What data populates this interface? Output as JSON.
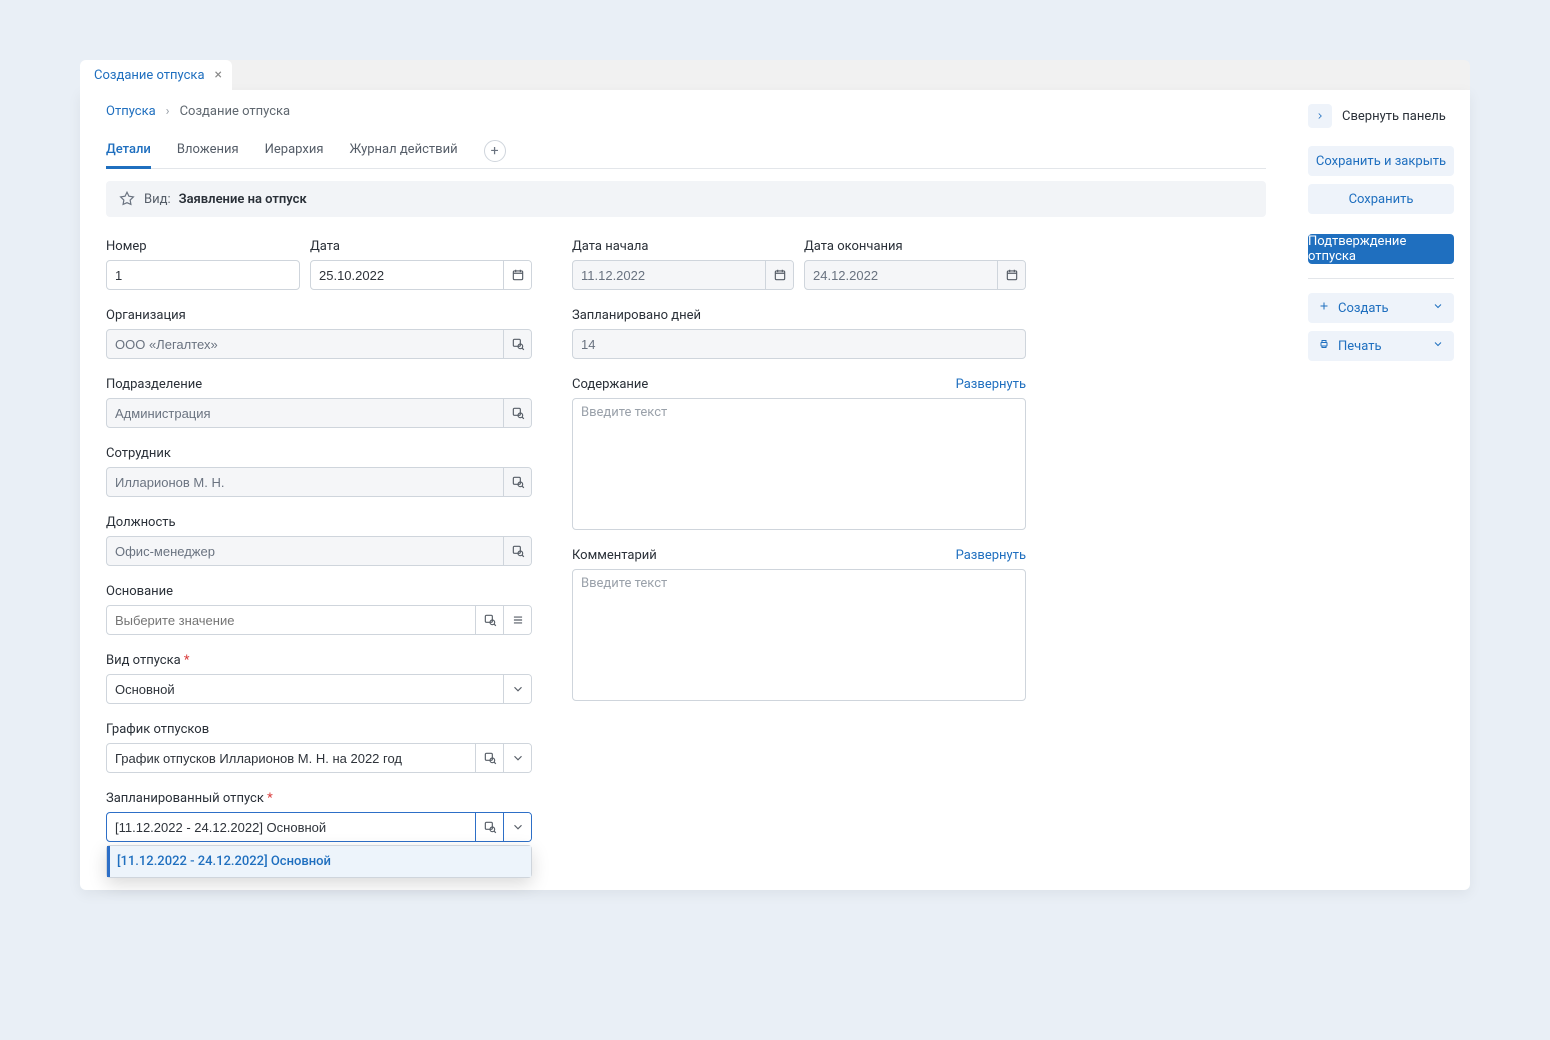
{
  "tab_title": "Создание отпуска",
  "breadcrumb": {
    "root": "Отпуска",
    "current": "Создание отпуска"
  },
  "nav_tabs": [
    "Детали",
    "Вложения",
    "Иерархия",
    "Журнал действий"
  ],
  "kind": {
    "label": "Вид:",
    "value": "Заявление на отпуск"
  },
  "left": {
    "number_label": "Номер",
    "number_value": "1",
    "date_label": "Дата",
    "date_value": "25.10.2022",
    "org_label": "Организация",
    "org_value": "ООО «Легалтех»",
    "dept_label": "Подразделение",
    "dept_value": "Администрация",
    "employee_label": "Сотрудник",
    "employee_value": "Илларионов М. Н.",
    "position_label": "Должность",
    "position_value": "Офис-менеджер",
    "reason_label": "Основание",
    "reason_placeholder": "Выберите значение",
    "vac_type_label": "Вид отпуска",
    "vac_type_value": "Основной",
    "schedule_label": "График отпусков",
    "schedule_value": "График отпусков Илларионов М. Н. на 2022 год",
    "planned_label": "Запланированный отпуск",
    "planned_value": "[11.12.2022 - 24.12.2022] Основной",
    "planned_option": "[11.12.2022 - 24.12.2022] Основной"
  },
  "right": {
    "start_label": "Дата начала",
    "start_value": "11.12.2022",
    "end_label": "Дата окончания",
    "end_value": "24.12.2022",
    "days_label": "Запланировано дней",
    "days_value": "14",
    "content_label": "Содержание",
    "content_placeholder": "Введите текст",
    "comment_label": "Комментарий",
    "comment_placeholder": "Введите текст",
    "expand": "Развернуть"
  },
  "side": {
    "collapse": "Свернуть панель",
    "save_close": "Сохранить и закрыть",
    "save": "Сохранить",
    "confirm": "Подтверждение отпуска",
    "create": "Создать",
    "print": "Печать"
  }
}
